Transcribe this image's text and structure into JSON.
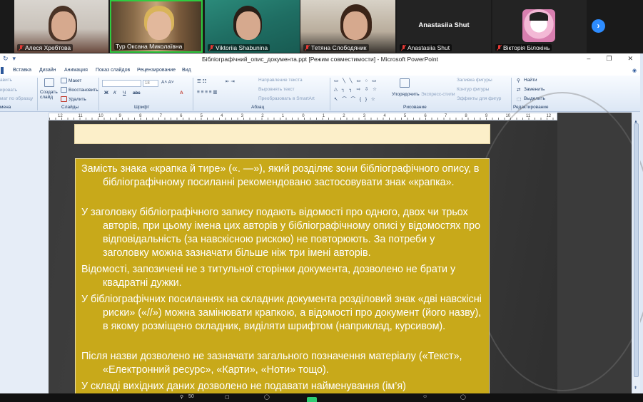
{
  "zoom": {
    "participants": [
      {
        "name": "Алеся Хребтова",
        "muted": true,
        "video": true
      },
      {
        "name": "Тур Оксана Миколаївна",
        "muted": false,
        "video": true,
        "active_speaker": true
      },
      {
        "name": "Viktoriia Shabunina",
        "muted": true,
        "video": true
      },
      {
        "name": "Тетяна Слободяник",
        "muted": true,
        "video": true
      },
      {
        "name": "Anastasiia Shut",
        "muted": true,
        "video": false
      },
      {
        "name": "Вікторія Білокінь",
        "muted": true,
        "video": false
      }
    ],
    "next_icon": "chevron-right-icon",
    "active_speaker_color": "#2ecc40"
  },
  "window": {
    "title": "Бібліографічний_опис_документа.ppt [Режим совместимости] - Microsoft PowerPoint",
    "minimize": "–",
    "restore": "❐",
    "close": "✕"
  },
  "ribbon": {
    "tabs": [
      "Вставка",
      "Дизайн",
      "Анимация",
      "Показ слайдов",
      "Рецензирование",
      "Вид"
    ],
    "clipboard": {
      "paste_label": "авить",
      "cut": "ировать",
      "format": "мат по образцу",
      "group": "мена"
    },
    "slides": {
      "new_slide": "Создать слайд",
      "layout": "Макет",
      "reset": "Восстановить",
      "delete": "Удалить",
      "group": "Слайды"
    },
    "font": {
      "size": "18",
      "group": "Шрифт"
    },
    "paragraph": {
      "text_direction": "Направление текста",
      "align_text": "Выровнять текст",
      "smartart": "Преобразовать в SmartArt",
      "group": "Абзац"
    },
    "drawing": {
      "arrange": "Упорядочить",
      "quick_styles": "Экспресс-стили",
      "fill": "Заливка фигуры",
      "outline": "Контур фигуры",
      "effects": "Эффекты для фигур",
      "group": "Рисование"
    },
    "editing": {
      "find": "Найти",
      "replace": "Заменить",
      "select": "Выделить",
      "group": "Редактирование"
    }
  },
  "ruler": {
    "labels": [
      "12",
      "11",
      "10",
      "9",
      "8",
      "7",
      "6",
      "5",
      "4",
      "3",
      "2",
      "1",
      "0",
      "1",
      "2",
      "3",
      "4",
      "5",
      "6",
      "7",
      "8",
      "9",
      "10",
      "11",
      "12"
    ]
  },
  "slide": {
    "colors": {
      "text_box": "#c8a91a",
      "top_box": "#fcefc9",
      "text": "#ffffff"
    },
    "bullets": [
      "Замість знака «крапка й тире» («. —»), який розділяє зони бібліографічного опису, в бібліографічному посиланні рекомендовано застосовувати знак «крапка».",
      "У заголовку бібліографічного запису подають відомості про одного, двох чи трьох авторів, при цьому імена цих авторів у бібліографічному описі у відомостях про відповідальність (за навскісною рискою) не повторюють. За потреби у заголовку можна зазначати більше ніж три імені авторів.",
      "Відомості, запозичені не з титульної сторінки документа, дозволено не брати у квадратні дужки.",
      "У бібліографічних посиланнях на складник документа розділовий знак «дві навскісні риски» («//») можна замінювати крапкою, а відомості про документ (його назву), в якому розміщено складник, виділяти шрифтом (наприклад, курсивом).",
      "Після назви дозволено не зазначати загального позначення матеріалу («Текст», «Електронний ресурс», «Карти», «Ноти» тощо).",
      "У складі вихідних даних дозволено не подавати найменування (ім’я)"
    ]
  },
  "taskbar": {
    "zoom_value": "50"
  }
}
